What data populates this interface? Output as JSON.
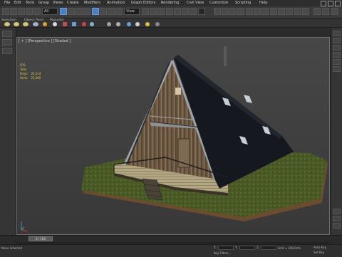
{
  "menu": {
    "items": [
      "File",
      "Edit",
      "Tools",
      "Group",
      "Views",
      "Create",
      "Modifiers",
      "Animation",
      "Graph Editors",
      "Rendering",
      "Civil View",
      "Customize",
      "Scripting",
      "Help"
    ]
  },
  "toolbar": {
    "selection_filter": "All",
    "view_dropdown": "View"
  },
  "ribbon": {
    "tabs": [
      "Selection",
      "Object Paint",
      "Populate"
    ]
  },
  "viewport": {
    "label": "[ + ] [Perspective ] [Shaded ]",
    "fps_label": "FPS:",
    "stats": "Total\nPolys:   22,514\nVerts:   25,960"
  },
  "timeline": {
    "frame_readout": "0 / 100"
  },
  "status": {
    "selection_text": "None Selected",
    "x_label": "X:",
    "y_label": "Y:",
    "z_label": "Z:",
    "grid_text": "Grid = 100,0cm",
    "autokey_label": "Auto Key",
    "setkey_label": "Set Key",
    "key_filters_label": "Key Filters..."
  },
  "colors": {
    "accent_blue": "#4d7fc0",
    "viewport_bg": "#3d3d3d",
    "stats_text": "#e2c54a"
  }
}
